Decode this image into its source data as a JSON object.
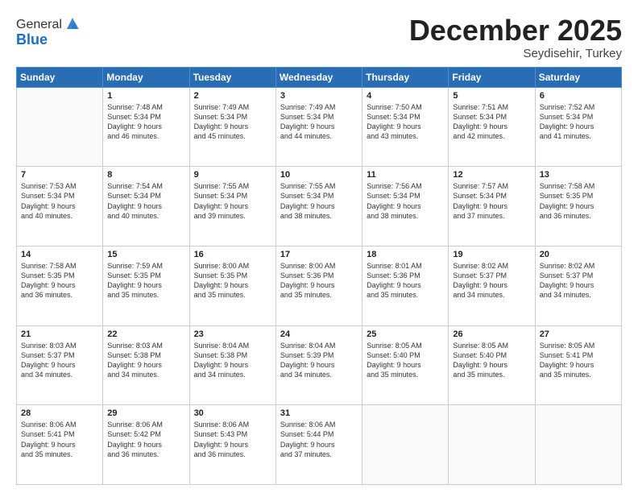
{
  "header": {
    "logo_general": "General",
    "logo_blue": "Blue",
    "month": "December 2025",
    "location": "Seydisehir, Turkey"
  },
  "days_of_week": [
    "Sunday",
    "Monday",
    "Tuesday",
    "Wednesday",
    "Thursday",
    "Friday",
    "Saturday"
  ],
  "weeks": [
    [
      {
        "day": "",
        "info": ""
      },
      {
        "day": "1",
        "info": "Sunrise: 7:48 AM\nSunset: 5:34 PM\nDaylight: 9 hours\nand 46 minutes."
      },
      {
        "day": "2",
        "info": "Sunrise: 7:49 AM\nSunset: 5:34 PM\nDaylight: 9 hours\nand 45 minutes."
      },
      {
        "day": "3",
        "info": "Sunrise: 7:49 AM\nSunset: 5:34 PM\nDaylight: 9 hours\nand 44 minutes."
      },
      {
        "day": "4",
        "info": "Sunrise: 7:50 AM\nSunset: 5:34 PM\nDaylight: 9 hours\nand 43 minutes."
      },
      {
        "day": "5",
        "info": "Sunrise: 7:51 AM\nSunset: 5:34 PM\nDaylight: 9 hours\nand 42 minutes."
      },
      {
        "day": "6",
        "info": "Sunrise: 7:52 AM\nSunset: 5:34 PM\nDaylight: 9 hours\nand 41 minutes."
      }
    ],
    [
      {
        "day": "7",
        "info": "Sunrise: 7:53 AM\nSunset: 5:34 PM\nDaylight: 9 hours\nand 40 minutes."
      },
      {
        "day": "8",
        "info": "Sunrise: 7:54 AM\nSunset: 5:34 PM\nDaylight: 9 hours\nand 40 minutes."
      },
      {
        "day": "9",
        "info": "Sunrise: 7:55 AM\nSunset: 5:34 PM\nDaylight: 9 hours\nand 39 minutes."
      },
      {
        "day": "10",
        "info": "Sunrise: 7:55 AM\nSunset: 5:34 PM\nDaylight: 9 hours\nand 38 minutes."
      },
      {
        "day": "11",
        "info": "Sunrise: 7:56 AM\nSunset: 5:34 PM\nDaylight: 9 hours\nand 38 minutes."
      },
      {
        "day": "12",
        "info": "Sunrise: 7:57 AM\nSunset: 5:34 PM\nDaylight: 9 hours\nand 37 minutes."
      },
      {
        "day": "13",
        "info": "Sunrise: 7:58 AM\nSunset: 5:35 PM\nDaylight: 9 hours\nand 36 minutes."
      }
    ],
    [
      {
        "day": "14",
        "info": "Sunrise: 7:58 AM\nSunset: 5:35 PM\nDaylight: 9 hours\nand 36 minutes."
      },
      {
        "day": "15",
        "info": "Sunrise: 7:59 AM\nSunset: 5:35 PM\nDaylight: 9 hours\nand 35 minutes."
      },
      {
        "day": "16",
        "info": "Sunrise: 8:00 AM\nSunset: 5:35 PM\nDaylight: 9 hours\nand 35 minutes."
      },
      {
        "day": "17",
        "info": "Sunrise: 8:00 AM\nSunset: 5:36 PM\nDaylight: 9 hours\nand 35 minutes."
      },
      {
        "day": "18",
        "info": "Sunrise: 8:01 AM\nSunset: 5:36 PM\nDaylight: 9 hours\nand 35 minutes."
      },
      {
        "day": "19",
        "info": "Sunrise: 8:02 AM\nSunset: 5:37 PM\nDaylight: 9 hours\nand 34 minutes."
      },
      {
        "day": "20",
        "info": "Sunrise: 8:02 AM\nSunset: 5:37 PM\nDaylight: 9 hours\nand 34 minutes."
      }
    ],
    [
      {
        "day": "21",
        "info": "Sunrise: 8:03 AM\nSunset: 5:37 PM\nDaylight: 9 hours\nand 34 minutes."
      },
      {
        "day": "22",
        "info": "Sunrise: 8:03 AM\nSunset: 5:38 PM\nDaylight: 9 hours\nand 34 minutes."
      },
      {
        "day": "23",
        "info": "Sunrise: 8:04 AM\nSunset: 5:38 PM\nDaylight: 9 hours\nand 34 minutes."
      },
      {
        "day": "24",
        "info": "Sunrise: 8:04 AM\nSunset: 5:39 PM\nDaylight: 9 hours\nand 34 minutes."
      },
      {
        "day": "25",
        "info": "Sunrise: 8:05 AM\nSunset: 5:40 PM\nDaylight: 9 hours\nand 35 minutes."
      },
      {
        "day": "26",
        "info": "Sunrise: 8:05 AM\nSunset: 5:40 PM\nDaylight: 9 hours\nand 35 minutes."
      },
      {
        "day": "27",
        "info": "Sunrise: 8:05 AM\nSunset: 5:41 PM\nDaylight: 9 hours\nand 35 minutes."
      }
    ],
    [
      {
        "day": "28",
        "info": "Sunrise: 8:06 AM\nSunset: 5:41 PM\nDaylight: 9 hours\nand 35 minutes."
      },
      {
        "day": "29",
        "info": "Sunrise: 8:06 AM\nSunset: 5:42 PM\nDaylight: 9 hours\nand 36 minutes."
      },
      {
        "day": "30",
        "info": "Sunrise: 8:06 AM\nSunset: 5:43 PM\nDaylight: 9 hours\nand 36 minutes."
      },
      {
        "day": "31",
        "info": "Sunrise: 8:06 AM\nSunset: 5:44 PM\nDaylight: 9 hours\nand 37 minutes."
      },
      {
        "day": "",
        "info": ""
      },
      {
        "day": "",
        "info": ""
      },
      {
        "day": "",
        "info": ""
      }
    ]
  ]
}
